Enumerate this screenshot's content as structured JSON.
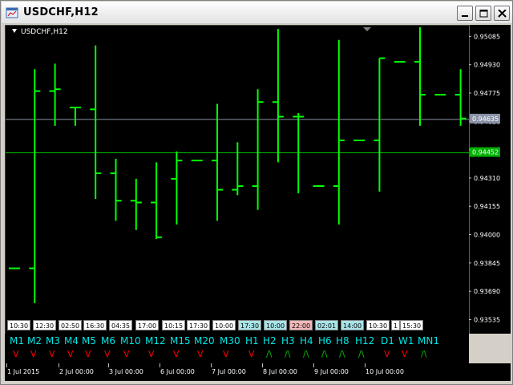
{
  "window": {
    "title": "USDCHF,H12"
  },
  "chart": {
    "label": "USDCHF,H12",
    "bar_color": "#00ff00",
    "background": "#000000"
  },
  "chart_data": {
    "type": "ohlc",
    "symbol": "USDCHF",
    "timeframe": "H12",
    "ylim": [
      0.93458,
      0.95148
    ],
    "y_ticks": [
      "0.95085",
      "0.94930",
      "0.94775",
      "0.94620",
      "0.94465",
      "0.94310",
      "0.94155",
      "0.94000",
      "0.93845",
      "0.93690",
      "0.93535"
    ],
    "bid_line": {
      "value": 0.94635,
      "label": "0.94635",
      "color": "#b0b8c8"
    },
    "ask_line": {
      "value": 0.94452,
      "label": "0.94452",
      "color": "#00c000"
    },
    "x_labels": [
      "1 Jul 2015",
      "2 Jul 00:00",
      "3 Jul 00:00",
      "6 Jul 00:00",
      "7 Jul 00:00",
      "8 Jul 00:00",
      "9 Jul 00:00",
      "10 Jul 00:00"
    ],
    "bars": [
      {
        "open": 0.9382,
        "high": 0.9382,
        "low": 0.9382,
        "close": 0.9382
      },
      {
        "open": 0.9382,
        "high": 0.9491,
        "low": 0.9363,
        "close": 0.9479
      },
      {
        "open": 0.9479,
        "high": 0.9494,
        "low": 0.946,
        "close": 0.948
      },
      {
        "open": 0.947,
        "high": 0.947,
        "low": 0.946,
        "close": 0.947
      },
      {
        "open": 0.9469,
        "high": 0.9504,
        "low": 0.942,
        "close": 0.9434
      },
      {
        "open": 0.9434,
        "high": 0.9442,
        "low": 0.9408,
        "close": 0.9419
      },
      {
        "open": 0.9419,
        "high": 0.9431,
        "low": 0.9403,
        "close": 0.9418
      },
      {
        "open": 0.9418,
        "high": 0.944,
        "low": 0.9398,
        "close": 0.9399
      },
      {
        "open": 0.9431,
        "high": 0.9446,
        "low": 0.9406,
        "close": 0.9441
      },
      {
        "open": 0.9441,
        "high": 0.9441,
        "low": 0.9441,
        "close": 0.9441
      },
      {
        "open": 0.9441,
        "high": 0.9472,
        "low": 0.9408,
        "close": 0.9425
      },
      {
        "open": 0.9425,
        "high": 0.9451,
        "low": 0.9422,
        "close": 0.9427
      },
      {
        "open": 0.9427,
        "high": 0.948,
        "low": 0.9414,
        "close": 0.9473
      },
      {
        "open": 0.9473,
        "high": 0.9513,
        "low": 0.944,
        "close": 0.9465
      },
      {
        "open": 0.9465,
        "high": 0.9467,
        "low": 0.9423,
        "close": 0.9465
      },
      {
        "open": 0.9427,
        "high": 0.9427,
        "low": 0.9427,
        "close": 0.9427
      },
      {
        "open": 0.9427,
        "high": 0.9507,
        "low": 0.9406,
        "close": 0.9452
      },
      {
        "open": 0.9452,
        "high": 0.9452,
        "low": 0.9452,
        "close": 0.9452
      },
      {
        "open": 0.9452,
        "high": 0.9497,
        "low": 0.9424,
        "close": 0.9497
      },
      {
        "open": 0.9495,
        "high": 0.9495,
        "low": 0.9495,
        "close": 0.9495
      },
      {
        "open": 0.9495,
        "high": 0.9514,
        "low": 0.946,
        "close": 0.9477
      },
      {
        "open": 0.9477,
        "high": 0.9477,
        "low": 0.9477,
        "close": 0.9477
      },
      {
        "open": 0.9477,
        "high": 0.9491,
        "low": 0.946,
        "close": 0.9464
      }
    ]
  },
  "session_boxes": [
    {
      "text": "10:30",
      "bg": "#ffffff"
    },
    {
      "text": "12:30",
      "bg": "#ffffff"
    },
    {
      "text": "02:50",
      "bg": "#ffffff"
    },
    {
      "text": "16:30",
      "bg": "#ffffff"
    },
    {
      "text": "04:35",
      "bg": "#ffffff"
    },
    {
      "text": "17:00",
      "bg": "#ffffff"
    },
    {
      "text": "10:15",
      "bg": "#ffffff"
    },
    {
      "text": "17:30",
      "bg": "#ffffff"
    },
    {
      "text": "10:00",
      "bg": "#ffffff"
    },
    {
      "text": "17:30",
      "bg": "#a8e4e8"
    },
    {
      "text": "10:00",
      "bg": "#a8e4e8"
    },
    {
      "text": "22:00",
      "bg": "#f4b8b8"
    },
    {
      "text": "02:01",
      "bg": "#a8e4e8"
    },
    {
      "text": "14:00",
      "bg": "#a8e4e8"
    },
    {
      "text": "10:30",
      "bg": "#ffffff"
    },
    {
      "text": "1",
      "bg": "#ffffff"
    },
    {
      "text": "15:30",
      "bg": "#ffffff"
    }
  ],
  "timeframes": [
    {
      "name": "M1",
      "dir": "V"
    },
    {
      "name": "M2",
      "dir": "V"
    },
    {
      "name": "M3",
      "dir": "V"
    },
    {
      "name": "M4",
      "dir": "V"
    },
    {
      "name": "M5",
      "dir": "V"
    },
    {
      "name": "M6",
      "dir": "V"
    },
    {
      "name": "M10",
      "dir": "V"
    },
    {
      "name": "M12",
      "dir": "V"
    },
    {
      "name": "M15",
      "dir": "V"
    },
    {
      "name": "M20",
      "dir": "V"
    },
    {
      "name": "M30",
      "dir": "V"
    },
    {
      "name": "H1",
      "dir": "V"
    },
    {
      "name": "H2",
      "dir": "/\\"
    },
    {
      "name": "H3",
      "dir": "/\\"
    },
    {
      "name": "H4",
      "dir": "/\\"
    },
    {
      "name": "H6",
      "dir": "/\\"
    },
    {
      "name": "H8",
      "dir": "/\\"
    },
    {
      "name": "H12",
      "dir": "/\\"
    },
    {
      "name": "D1",
      "dir": "V"
    },
    {
      "name": "W1",
      "dir": "V"
    },
    {
      "name": "MN1",
      "dir": "/\\"
    }
  ],
  "colors": {
    "up": "#00c000",
    "down": "#ff0000",
    "tf_label": "#00e5e5",
    "panel_bg": "#000000"
  }
}
